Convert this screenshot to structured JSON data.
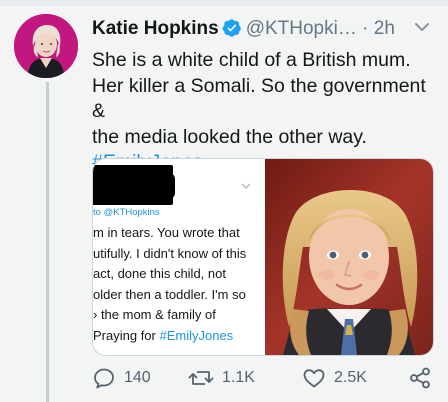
{
  "tweet": {
    "author_name": "Katie Hopkins",
    "handle": "@KTHopki…",
    "separator": "·",
    "time": "2h",
    "text_lines": [
      "She is a white child of a British mum.",
      "Her killer a Somali. So the government &",
      "the media looked the other way."
    ],
    "hashtag": "#EmilyJones"
  },
  "embedded": {
    "reply_to": "to @KTHopkins",
    "lines": [
      "m in tears. You wrote that",
      "utifully. I didn't know of  this",
      " act, done this child, not",
      "older then a toddler. I'm so",
      "› the mom & family of",
      "Praying for "
    ],
    "hashtag": "#EmilyJones"
  },
  "actions": {
    "replies": "140",
    "retweets": "1.1K",
    "likes": "2.5K"
  },
  "colors": {
    "link": "#1b95e0",
    "verified": "#1da1f2",
    "secondary_text": "#657786"
  },
  "icons": [
    "verified-icon",
    "chevron-down-icon",
    "reply-icon",
    "retweet-icon",
    "like-icon",
    "share-icon"
  ]
}
